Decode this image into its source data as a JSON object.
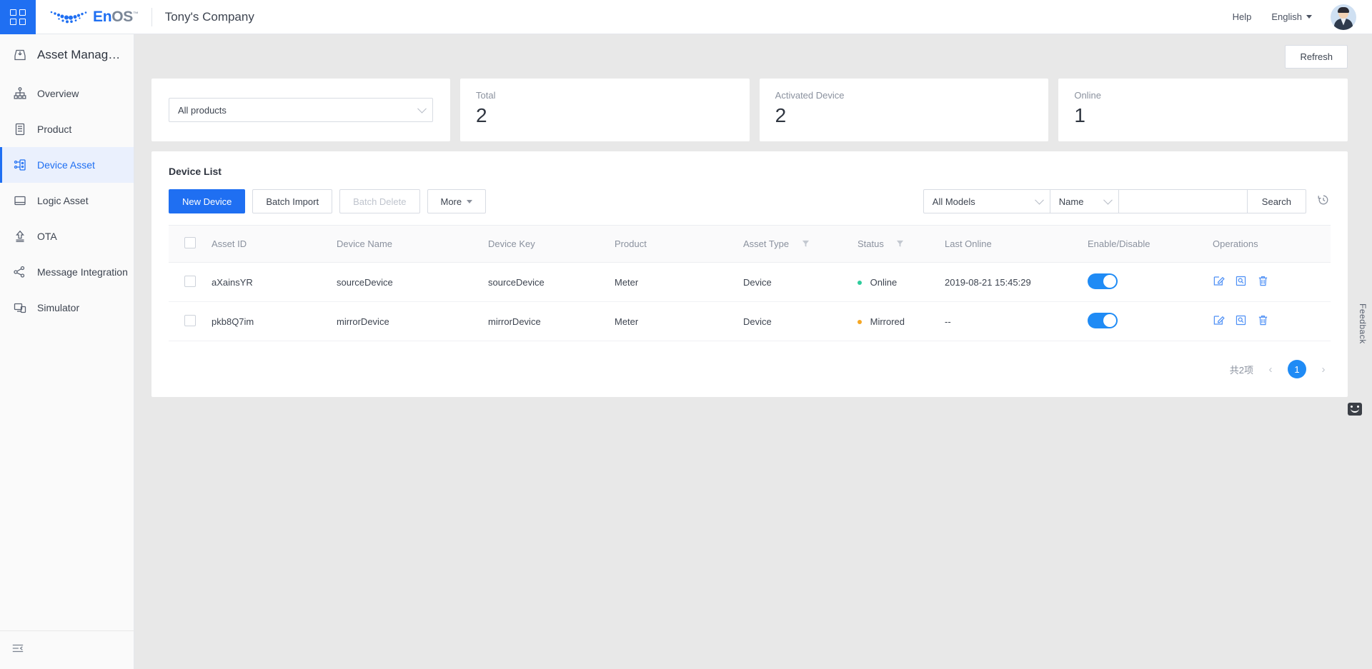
{
  "topbar": {
    "app_grid_icon": "grid-icon",
    "brand_en": "En",
    "brand_os": "OS",
    "brand_tm": "™",
    "company": "Tony's Company",
    "help_label": "Help",
    "language_label": "English",
    "avatar_icon": "user-avatar"
  },
  "sidebar": {
    "title": "Asset Manag…",
    "title_icon": "inbox-download-icon",
    "items": [
      {
        "label": "Overview",
        "icon": "hierarchy-icon",
        "active": false
      },
      {
        "label": "Product",
        "icon": "document-icon",
        "active": false
      },
      {
        "label": "Device Asset",
        "icon": "device-node-icon",
        "active": true
      },
      {
        "label": "Logic Asset",
        "icon": "drawer-icon",
        "active": false
      },
      {
        "label": "OTA",
        "icon": "upload-arrow-icon",
        "active": false
      },
      {
        "label": "Message Integration",
        "icon": "share-nodes-icon",
        "active": false
      },
      {
        "label": "Simulator",
        "icon": "monitor-copy-icon",
        "active": false
      }
    ],
    "collapse_icon": "collapse-sidebar-icon"
  },
  "main": {
    "refresh_label": "Refresh",
    "product_filter": {
      "value": "All products",
      "chevron_icon": "chevron-down-icon"
    },
    "stats": [
      {
        "label": "Total",
        "value": "2"
      },
      {
        "label": "Activated Device",
        "value": "2"
      },
      {
        "label": "Online",
        "value": "1"
      }
    ],
    "panel_title": "Device List",
    "buttons": {
      "new_device": "New Device",
      "batch_import": "Batch Import",
      "batch_delete": "Batch Delete",
      "more": "More"
    },
    "filters": {
      "model": "All Models",
      "field": "Name",
      "query_value": "",
      "query_placeholder": "",
      "search_label": "Search",
      "history_icon": "history-clock-icon"
    },
    "table": {
      "columns": [
        {
          "label": "",
          "key": "check"
        },
        {
          "label": "Asset ID",
          "key": "asset_id"
        },
        {
          "label": "Device Name",
          "key": "device_name"
        },
        {
          "label": "Device Key",
          "key": "device_key"
        },
        {
          "label": "Product",
          "key": "product"
        },
        {
          "label": "Asset Type",
          "key": "asset_type",
          "filter": true
        },
        {
          "label": "Status",
          "key": "status",
          "filter": true
        },
        {
          "label": "Last Online",
          "key": "last_online"
        },
        {
          "label": "Enable/Disable",
          "key": "enable"
        },
        {
          "label": "Operations",
          "key": "operations"
        }
      ],
      "rows": [
        {
          "asset_id": "aXainsYR",
          "device_name": "sourceDevice",
          "device_key": "sourceDevice",
          "product": "Meter",
          "asset_type": "Device",
          "status": "Online",
          "status_color": "#2ecc9c",
          "last_online": "2019-08-21 15:45:29",
          "enabled": true
        },
        {
          "asset_id": "pkb8Q7im",
          "device_name": "mirrorDevice",
          "device_key": "mirrorDevice",
          "product": "Meter",
          "asset_type": "Device",
          "status": "Mirrored",
          "status_color": "#f5a623",
          "last_online": "--",
          "enabled": true
        }
      ],
      "op_icons": [
        "edit-icon",
        "view-detail-icon",
        "delete-icon"
      ]
    },
    "pagination": {
      "total_text": "共2项",
      "prev": "‹",
      "page": "1",
      "next": "›"
    }
  },
  "feedback": {
    "label": "Feedback",
    "icon": "smiley-icon"
  },
  "colors": {
    "primary": "#1f6ff2",
    "toggle_on": "#1f8bf5",
    "online": "#2ecc9c",
    "mirrored": "#f5a623"
  }
}
